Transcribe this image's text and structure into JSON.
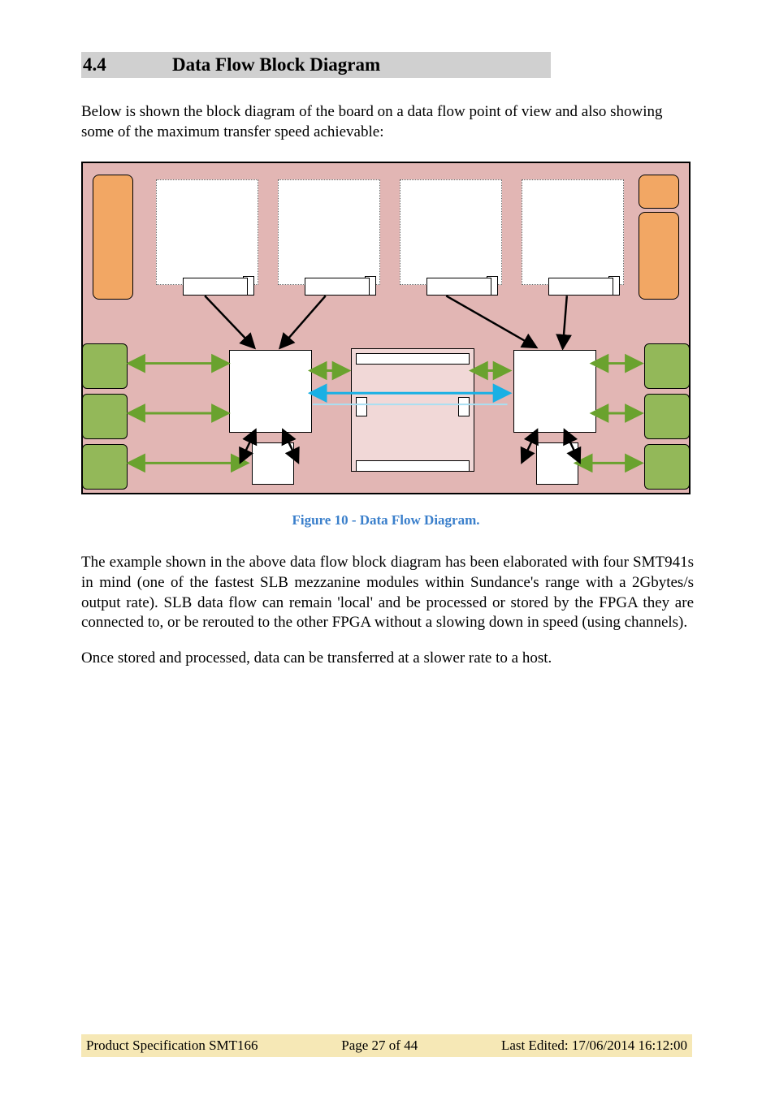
{
  "heading": {
    "number": "4.4",
    "title": "Data Flow Block Diagram"
  },
  "intro": "Below is shown the block diagram of the board on a data flow point of view and also showing some of the maximum transfer speed achievable:",
  "caption": "Figure 10 - Data Flow Diagram.",
  "paragraph1": "The example shown in the above data flow block diagram has been elaborated with four SMT941s in mind (one of the fastest SLB mezzanine modules within Sundance's range with a 2Gbytes/s output rate). SLB data flow can remain 'local' and be processed or stored by the FPGA they are connected to, or be rerouted to the other FPGA without a slowing down in speed (using channels).",
  "paragraph2": "Once stored and processed, data can be transferred at a slower rate to a host.",
  "footer": {
    "left": "Product Specification SMT166",
    "center": "Page 27 of 44",
    "right": "Last Edited: 17/06/2014 16:12:00"
  }
}
